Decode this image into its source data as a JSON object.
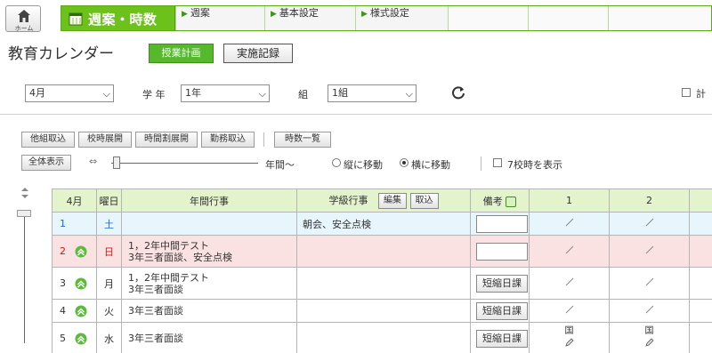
{
  "nav": {
    "home_label": "ホーム",
    "title": "週案・時数",
    "tabs": [
      {
        "label": "週案"
      },
      {
        "label": "基本設定"
      },
      {
        "label": "様式設定"
      }
    ]
  },
  "page": {
    "title": "教育カレンダー",
    "plan_button": "授業計画",
    "record_button": "実施記録"
  },
  "filters": {
    "month": "4月",
    "grade_label": "学 年",
    "grade": "1年",
    "class_label": "組",
    "class": "1組",
    "right_checkbox_label": "計"
  },
  "toolbar": {
    "buttons": [
      "他組取込",
      "校時展開",
      "時間割展開",
      "勤務取込",
      "時数一覧"
    ],
    "show_all": "全体表示",
    "range_label": "年間～",
    "radio_vertical": "縦に移動",
    "radio_horizontal": "横に移動",
    "checkbox_7": "7校時を表示"
  },
  "table": {
    "headers": {
      "month": "4月",
      "weekday": "曜日",
      "annual": "年間行事",
      "class_event": "学級行事",
      "edit": "編集",
      "import": "取込",
      "note": "備考",
      "period1": "1",
      "period2": "2"
    },
    "rows": [
      {
        "day": "1",
        "weekday": "土",
        "annual": "",
        "class_event": "朝会、安全点検",
        "note_type": "box",
        "p1": "slash",
        "p2": "slash"
      },
      {
        "day": "2",
        "weekday": "日",
        "annual_1": "1，2年中間テスト",
        "annual_2": "3年三者面談、安全点検",
        "class_event": "",
        "note_type": "box",
        "p1": "slash",
        "p2": "slash"
      },
      {
        "day": "3",
        "weekday": "月",
        "annual_1": "1，2年中間テスト",
        "annual_2": "3年三者面談",
        "class_event": "",
        "note_type": "button",
        "note": "短縮日課",
        "p1": "slash",
        "p2": "slash"
      },
      {
        "day": "4",
        "weekday": "火",
        "annual": "3年三者面談",
        "class_event": "",
        "note_type": "button",
        "note": "短縮日課",
        "p1": "slash",
        "p2": "slash"
      },
      {
        "day": "5",
        "weekday": "水",
        "annual": "3年三者面談",
        "class_event": "",
        "note_type": "button",
        "note": "短縮日課",
        "p1_subject": "国",
        "p2_subject": "国"
      }
    ]
  }
}
